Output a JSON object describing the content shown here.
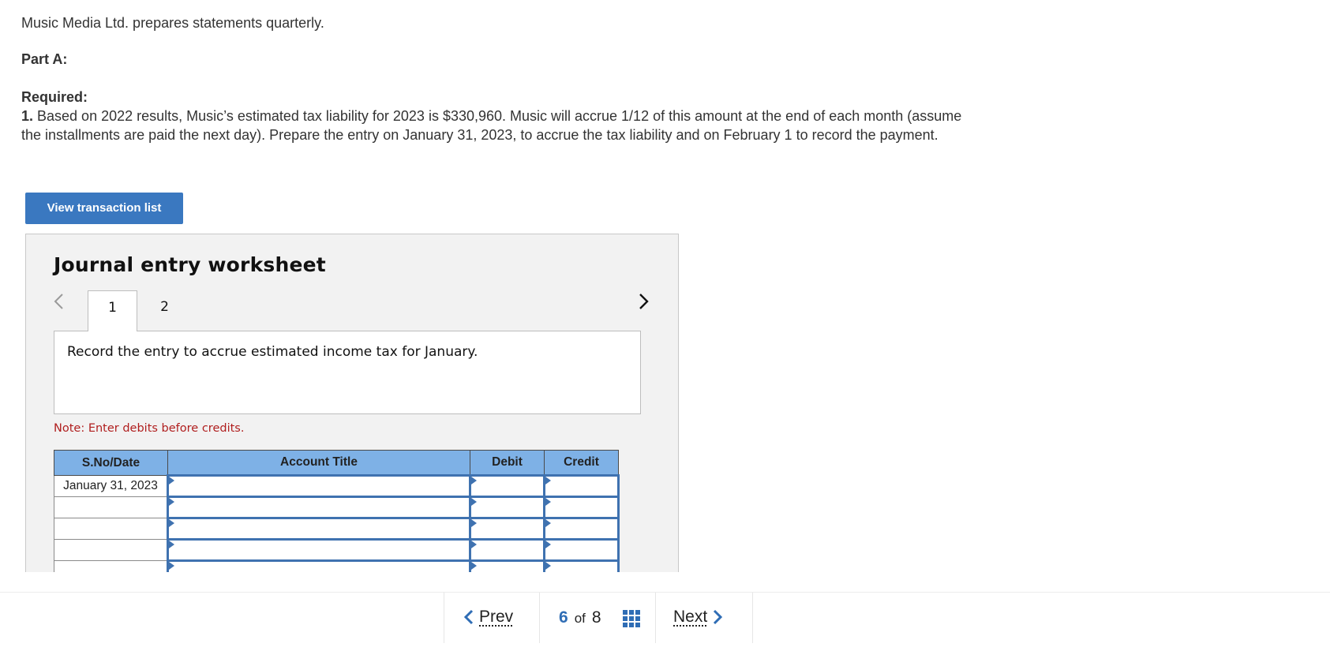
{
  "intro": "Music Media Ltd. prepares statements quarterly.",
  "part_label": "Part A:",
  "required": {
    "label": "Required:",
    "number": "1.",
    "text": " Based on 2022 results, Music’s estimated tax liability for 2023 is $330,960. Music will accrue 1/12 of this amount at the end of each month (assume the installments are paid the next day). Prepare the entry on January 31, 2023, to accrue the tax liability and on February 1 to record the payment."
  },
  "view_button": "View transaction list",
  "worksheet": {
    "title": "Journal entry worksheet",
    "tabs": [
      {
        "label": "1"
      },
      {
        "label": "2"
      }
    ],
    "active_tab": 1,
    "instruction": "Record the entry to accrue estimated income tax for January.",
    "note": "Note: Enter debits before credits.",
    "table": {
      "headers": [
        "S.No/Date",
        "Account Title",
        "Debit",
        "Credit"
      ],
      "rows": [
        {
          "date": "January 31, 2023",
          "account": "",
          "debit": "",
          "credit": ""
        },
        {
          "date": "",
          "account": "",
          "debit": "",
          "credit": ""
        },
        {
          "date": "",
          "account": "",
          "debit": "",
          "credit": ""
        },
        {
          "date": "",
          "account": "",
          "debit": "",
          "credit": ""
        },
        {
          "date": "",
          "account": "",
          "debit": "",
          "credit": ""
        }
      ]
    }
  },
  "pager": {
    "prev_label": "Prev",
    "next_label": "Next",
    "current": "6",
    "of_label": "of",
    "total": "8"
  },
  "colors": {
    "accent": "#3a78c0",
    "header_fill": "#7eb1e6",
    "note": "#b01e1e",
    "input_border": "#3f72b0"
  }
}
